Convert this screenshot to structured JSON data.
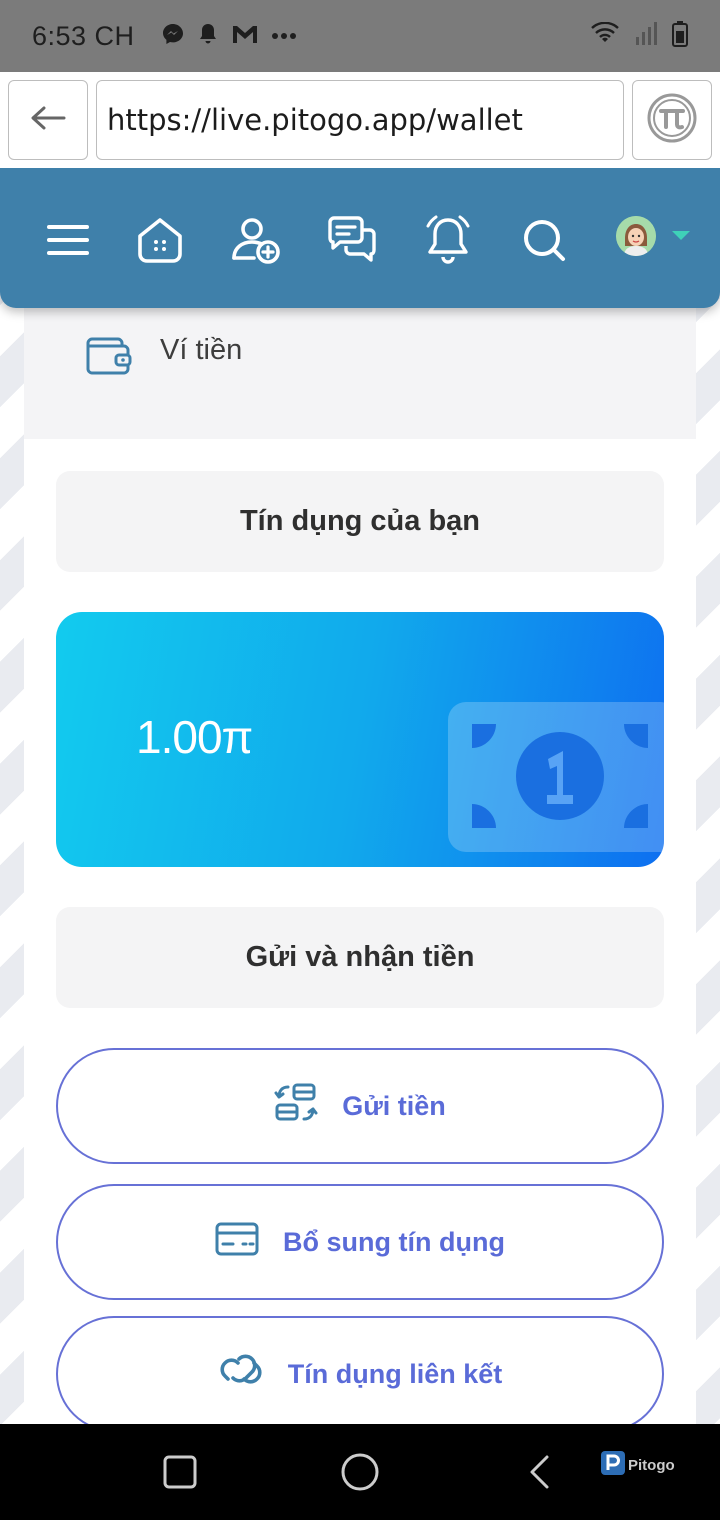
{
  "status_bar": {
    "time": "6:53 CH",
    "left_icons": [
      "messenger-icon",
      "notification-bell-icon",
      "gmail-icon",
      "more-dots-icon"
    ],
    "right_icons": [
      "wifi-icon",
      "signal-icon",
      "battery-icon"
    ]
  },
  "browser": {
    "url": "https://live.pitogo.app/wallet",
    "back_icon": "arrow-left-icon",
    "pi_icon": "pi-browser-icon"
  },
  "header": {
    "icons": [
      "menu-icon",
      "home-icon",
      "add-friend-icon",
      "messages-icon",
      "notifications-icon",
      "search-icon"
    ],
    "avatar_icon": "user-avatar",
    "accent_color": "#3f80aa"
  },
  "wallet": {
    "title": "Ví tiền"
  },
  "credit": {
    "heading": "Tín dụng của bạn",
    "amount": "1.00π"
  },
  "transfer": {
    "heading": "Gửi và nhận tiền",
    "buttons": [
      {
        "label": "Gửi tiền",
        "icon": "send-money-icon"
      },
      {
        "label": "Bổ sung tín dụng",
        "icon": "credit-card-icon"
      },
      {
        "label": "Tín dụng liên kết",
        "icon": "link-icon"
      }
    ]
  },
  "watermark": {
    "text": "Pitogo"
  },
  "nav_bar": {
    "icons": [
      "recents-square-icon",
      "home-circle-icon",
      "back-chevron-icon"
    ]
  }
}
